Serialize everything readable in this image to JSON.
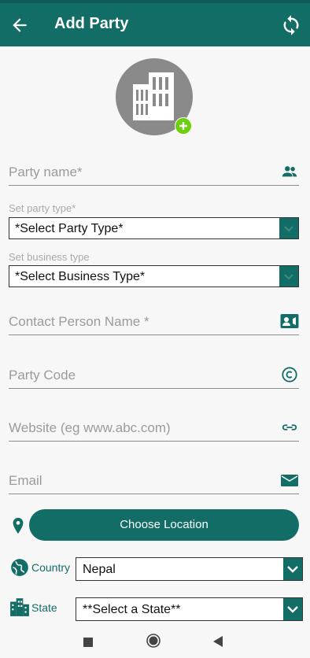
{
  "app_bar": {
    "title": "Add Party",
    "back_icon": "arrow-left-icon",
    "sync_icon": "sync-icon"
  },
  "avatar": {
    "icon": "office-building-icon",
    "add_icon": "plus-circle-icon"
  },
  "form": {
    "party_name": {
      "placeholder": "Party name*",
      "icon": "people-icon"
    },
    "party_type": {
      "label": "Set party type*",
      "selected": "*Select Party Type*"
    },
    "business_type": {
      "label": "Set business type",
      "selected": "*Select Business Type*"
    },
    "contact_person": {
      "placeholder": "Contact Person Name *",
      "icon": "contact-card-icon"
    },
    "party_code": {
      "placeholder": "Party Code",
      "icon": "copyright-icon"
    },
    "website": {
      "placeholder": "Website (eg www.abc.com)",
      "icon": "link-icon"
    },
    "email": {
      "placeholder": "Email",
      "icon": "mail-icon"
    },
    "location": {
      "button_label": "Choose Location",
      "icon": "location-pin-icon"
    },
    "country": {
      "label": "Country",
      "selected": "Nepal",
      "icon": "globe-icon"
    },
    "state": {
      "label": "State",
      "selected": "**Select a State**",
      "icon": "city-icon"
    }
  },
  "colors": {
    "primary": "#136d67",
    "accent_add": "#6ad10c"
  },
  "nav": {
    "recents_icon": "square-icon",
    "home_icon": "circle-icon",
    "back_icon": "triangle-back-icon"
  }
}
